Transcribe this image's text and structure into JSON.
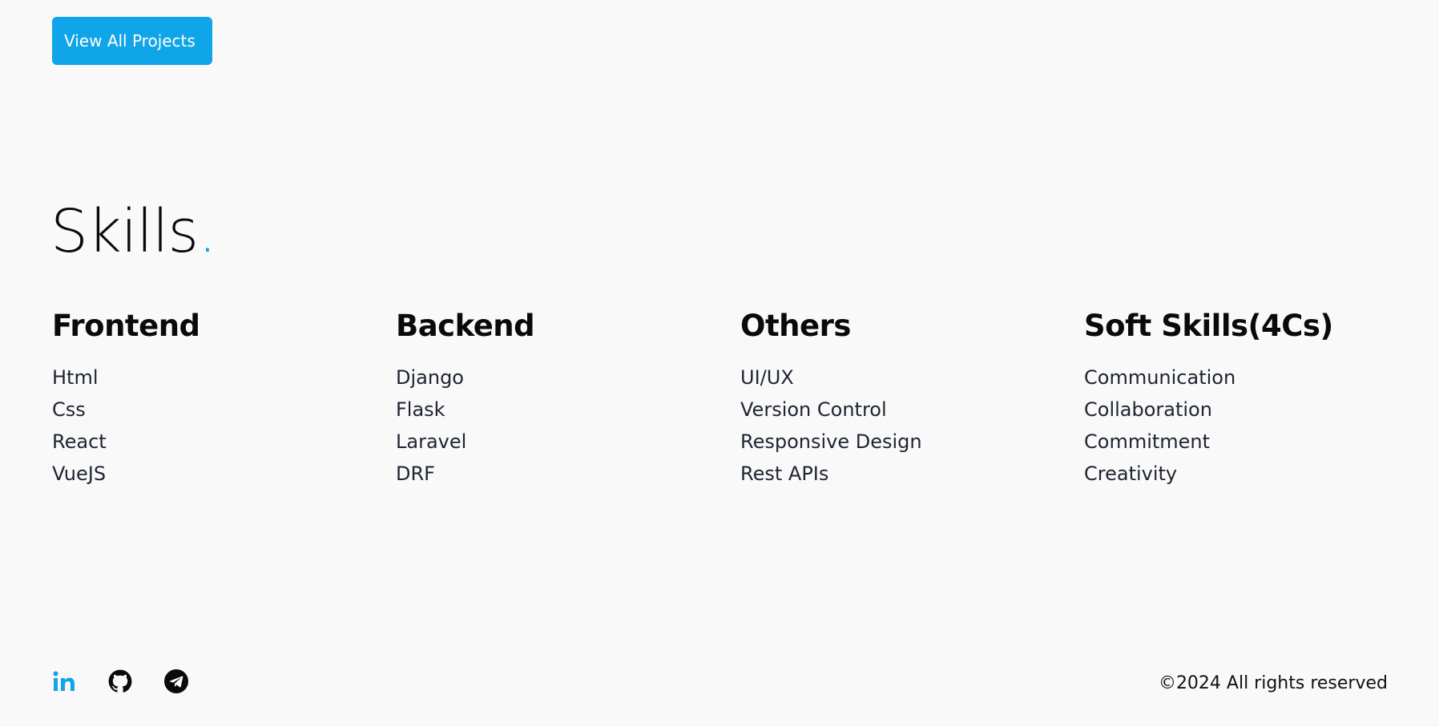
{
  "projects": {
    "view_all_label": "View All Projects"
  },
  "skills": {
    "title": "Skills",
    "title_dot": ".",
    "columns": [
      {
        "heading": "Frontend",
        "items": [
          "Html",
          "Css",
          "React",
          "VueJS"
        ]
      },
      {
        "heading": "Backend",
        "items": [
          "Django",
          "Flask",
          "Laravel",
          "DRF"
        ]
      },
      {
        "heading": "Others",
        "items": [
          "UI/UX",
          "Version Control",
          "Responsive Design",
          "Rest APIs"
        ]
      },
      {
        "heading": "Soft Skills(4Cs)",
        "items": [
          "Communication",
          "Collaboration",
          "Commitment",
          "Creativity"
        ]
      }
    ]
  },
  "footer": {
    "social_icons": [
      "linkedin-icon",
      "github-icon",
      "telegram-icon"
    ],
    "copyright": "©2024 All rights reserved"
  },
  "colors": {
    "accent": "#10a4e8",
    "background": "#f9f9f9",
    "text": "#0a0a0a"
  }
}
